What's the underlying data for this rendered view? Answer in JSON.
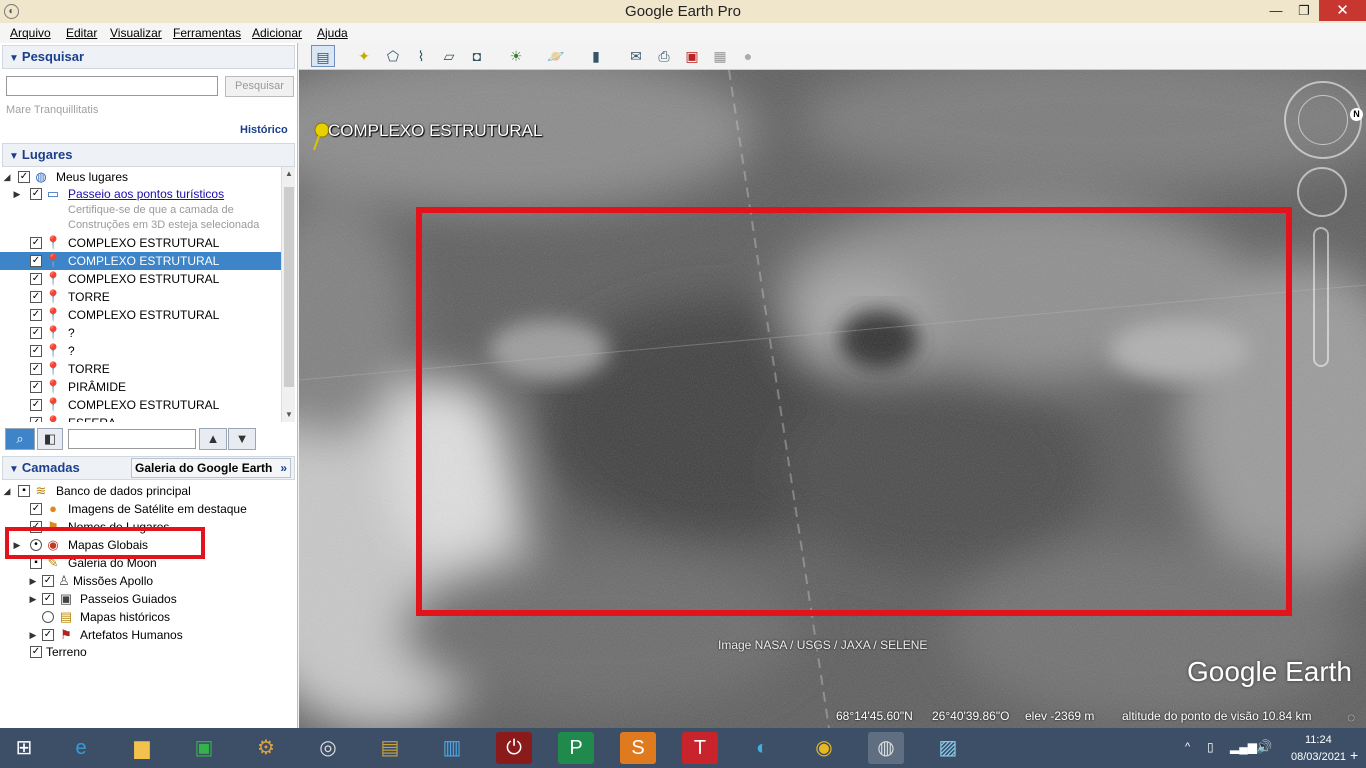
{
  "window": {
    "title": "Google Earth Pro",
    "min": "—",
    "max": "❐",
    "close": "✕"
  },
  "menu": [
    "Arquivo",
    "Editar",
    "Visualizar",
    "Ferramentas",
    "Adicionar",
    "Ajuda"
  ],
  "search": {
    "header": "Pesquisar",
    "button": "Pesquisar",
    "last_query": "Mare Tranquillitatis",
    "history": "Histórico"
  },
  "places": {
    "header": "Lugares",
    "items": [
      {
        "label": "Meus lugares"
      },
      {
        "label": "Passeio aos pontos turísticos"
      },
      {
        "label": "Certifique-se de que a camada de"
      },
      {
        "label": "Construções em 3D esteja selecionada"
      },
      {
        "label": "COMPLEXO ESTRUTURAL"
      },
      {
        "label": "COMPLEXO ESTRUTURAL"
      },
      {
        "label": "COMPLEXO ESTRUTURAL"
      },
      {
        "label": "TORRE"
      },
      {
        "label": "COMPLEXO ESTRUTURAL"
      },
      {
        "label": "?"
      },
      {
        "label": "?"
      },
      {
        "label": "TORRE"
      },
      {
        "label": "PIRÂMIDE"
      },
      {
        "label": "COMPLEXO ESTRUTURAL"
      },
      {
        "label": "ESFERA"
      }
    ]
  },
  "layers": {
    "header": "Camadas",
    "gallery_button": "Galeria do Google Earth",
    "items": [
      {
        "label": "Banco de dados principal"
      },
      {
        "label": "Imagens de Satélite em destaque"
      },
      {
        "label": "Nomes de Lugares"
      },
      {
        "label": "Mapas Globais"
      },
      {
        "label": "Galeria do Moon"
      },
      {
        "label": "Missões Apollo"
      },
      {
        "label": "Passeios Guiados"
      },
      {
        "label": "Mapas históricos"
      },
      {
        "label": "Artefatos Humanos"
      },
      {
        "label": "Terreno"
      }
    ]
  },
  "map": {
    "placemark": "COMPLEXO ESTRUTURAL",
    "attribution": "Image NASA / USGS / JAXA / SELENE",
    "logo": "Google Earth",
    "compass_north": "N",
    "highlight_color": "#e3131b"
  },
  "status": {
    "lat": "68°14'45.60\"N",
    "lon": "26°40'39.86\"O",
    "elev": "elev  -2369 m",
    "eye_alt": "altitude do ponto de visão  10.84 km"
  },
  "taskbar": {
    "time": "11:24",
    "date": "08/03/2021",
    "apps": [
      "internet-explorer",
      "file-explorer",
      "store",
      "app-gear",
      "speaker",
      "doc",
      "settings-app",
      "power",
      "publisher",
      "sway",
      "t-app",
      "edge",
      "chrome",
      "google-earth-pro",
      "photos"
    ]
  }
}
